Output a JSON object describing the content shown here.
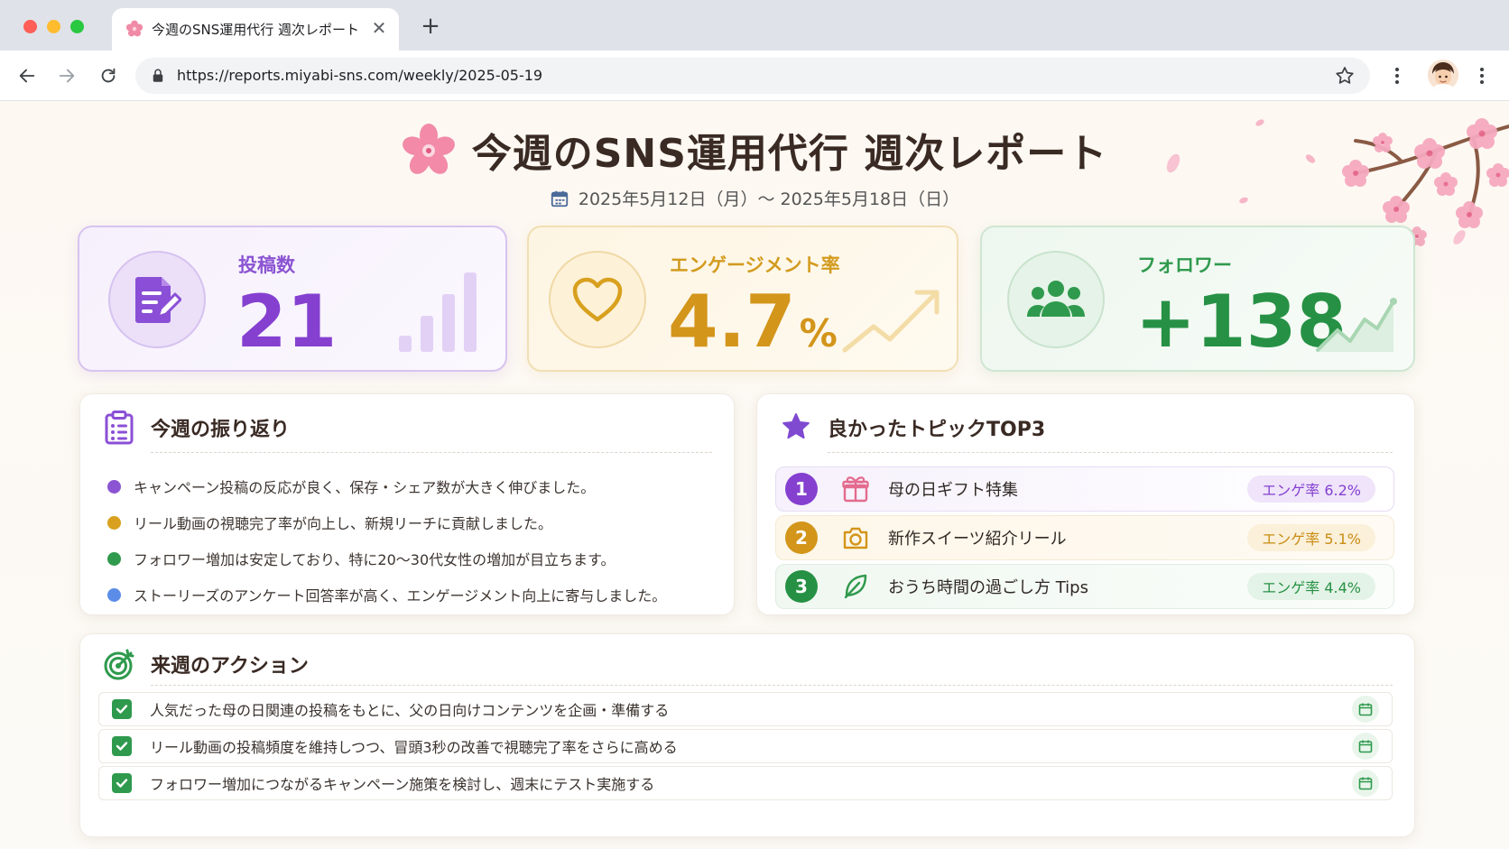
{
  "browser": {
    "tab_title": "今週のSNS運用代行 週次レポート",
    "tab_close": "✕",
    "new_tab": "+",
    "url": "https://reports.miyabi-sns.com/weekly/2025-05-19"
  },
  "report": {
    "title": "今週のSNS運用代行 週次レポート",
    "date_range": "2025年5月12日（月）〜 2025年5月18日（日）"
  },
  "kpis": {
    "posts": {
      "label": "投稿数",
      "value": "21",
      "icon": "document-edit-icon",
      "color": "#8540d0"
    },
    "engagement": {
      "label": "エンゲージメント率",
      "value": "4.7",
      "unit": "%",
      "icon": "heart-icon",
      "color": "#d3951a"
    },
    "followers": {
      "label": "フォロワー",
      "value": "+138",
      "icon": "users-icon",
      "color": "#269144"
    }
  },
  "reflection": {
    "title": "今週の振り返り",
    "items": [
      {
        "text": "キャンペーン投稿の反応が良く、保存・シェア数が大きく伸びました。",
        "color": "#8b54d2"
      },
      {
        "text": "リール動画の視聴完了率が向上し、新規リーチに貢献しました。",
        "color": "#d8a01e"
      },
      {
        "text": "フォロワー増加は安定しており、特に20〜30代女性の増加が目立ちます。",
        "color": "#2f9a4d"
      },
      {
        "text": "ストーリーズのアンケート回答率が高く、エンゲージメント向上に寄与しました。",
        "color": "#5b8de8"
      }
    ]
  },
  "topics": {
    "title": "良かったトピックTOP3",
    "items": [
      {
        "rank": "1",
        "name": "母の日ギフト特集",
        "badge": "エンゲ率 6.2%",
        "icon": "gift-icon",
        "color": "#8540d0"
      },
      {
        "rank": "2",
        "name": "新作スイーツ紹介リール",
        "badge": "エンゲ率 5.1%",
        "icon": "camera-icon",
        "color": "#d3951a"
      },
      {
        "rank": "3",
        "name": "おうち時間の過ごし方 Tips",
        "badge": "エンゲ率 4.4%",
        "icon": "leaf-icon",
        "color": "#269144"
      }
    ]
  },
  "actions": {
    "title": "来週のアクション",
    "items": [
      {
        "text": "人気だった母の日関連の投稿をもとに、父の日向けコンテンツを企画・準備する"
      },
      {
        "text": "リール動画の投稿頻度を維持しつつ、冒頭3秒の改善で視聴完了率をさらに高める"
      },
      {
        "text": "フォロワー増加につながるキャンペーン施策を検討し、週末にテスト実施する"
      }
    ]
  }
}
